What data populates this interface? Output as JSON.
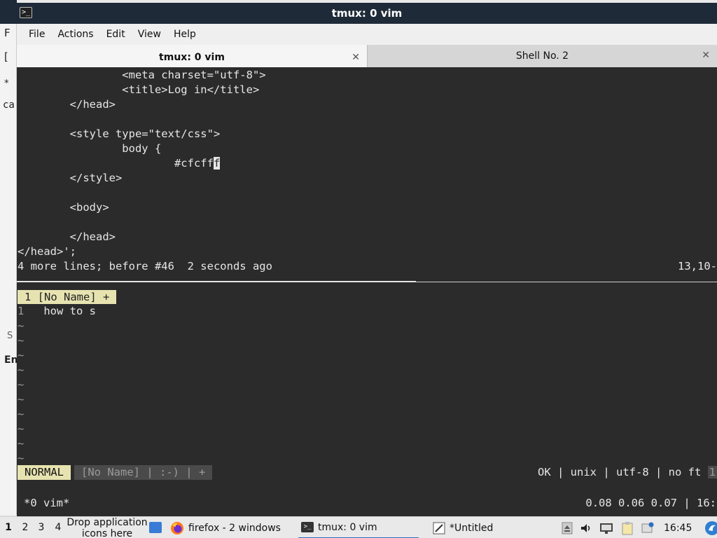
{
  "background_app": {
    "fragments": [
      "F",
      "[",
      "*",
      "ca",
      "S",
      "En"
    ]
  },
  "window": {
    "title": "tmux: 0 vim",
    "menu": [
      "File",
      "Actions",
      "Edit",
      "View",
      "Help"
    ],
    "tabs": [
      {
        "label": "tmux: 0 vim",
        "active": true
      },
      {
        "label": "Shell No. 2",
        "active": false
      }
    ]
  },
  "editor": {
    "top_lines": [
      "                <meta charset=\"utf-8\">",
      "                <title>Log in</title>",
      "        </head>",
      "",
      "        <style type=\"text/css\">",
      "                body {",
      "                        #cfcff",
      "        </style>",
      "",
      "        <body>",
      "",
      "        </head>",
      "</head>';"
    ],
    "cursor_char": "f",
    "message": "4 more lines; before #46  2 seconds ago",
    "position": "13,10-",
    "buffer_tab": "1 [No Name] +",
    "bottom_line_number": "1",
    "bottom_line_text": "how to s",
    "tilde_count": 10,
    "mode": "NORMAL",
    "buffer_info": "[No Name] | :-) | +",
    "right_status": "OK | unix | utf-8 | no ft ",
    "right_status_end": "1"
  },
  "tmux": {
    "left": "*0 vim*",
    "right": "0.08 0.06 0.07 | 16:"
  },
  "taskbar": {
    "workspaces": [
      "1",
      "2",
      "3",
      "4"
    ],
    "drop_text": "Drop application icons here",
    "tasks": [
      {
        "label": "firefox - 2 windows",
        "icon": "firefox-icon"
      },
      {
        "label": "tmux: 0 vim",
        "icon": "terminal-icon"
      },
      {
        "label": "*Untitled",
        "icon": "text-editor-icon"
      }
    ],
    "clock": "16:45",
    "accent": "#2f6fbf"
  }
}
